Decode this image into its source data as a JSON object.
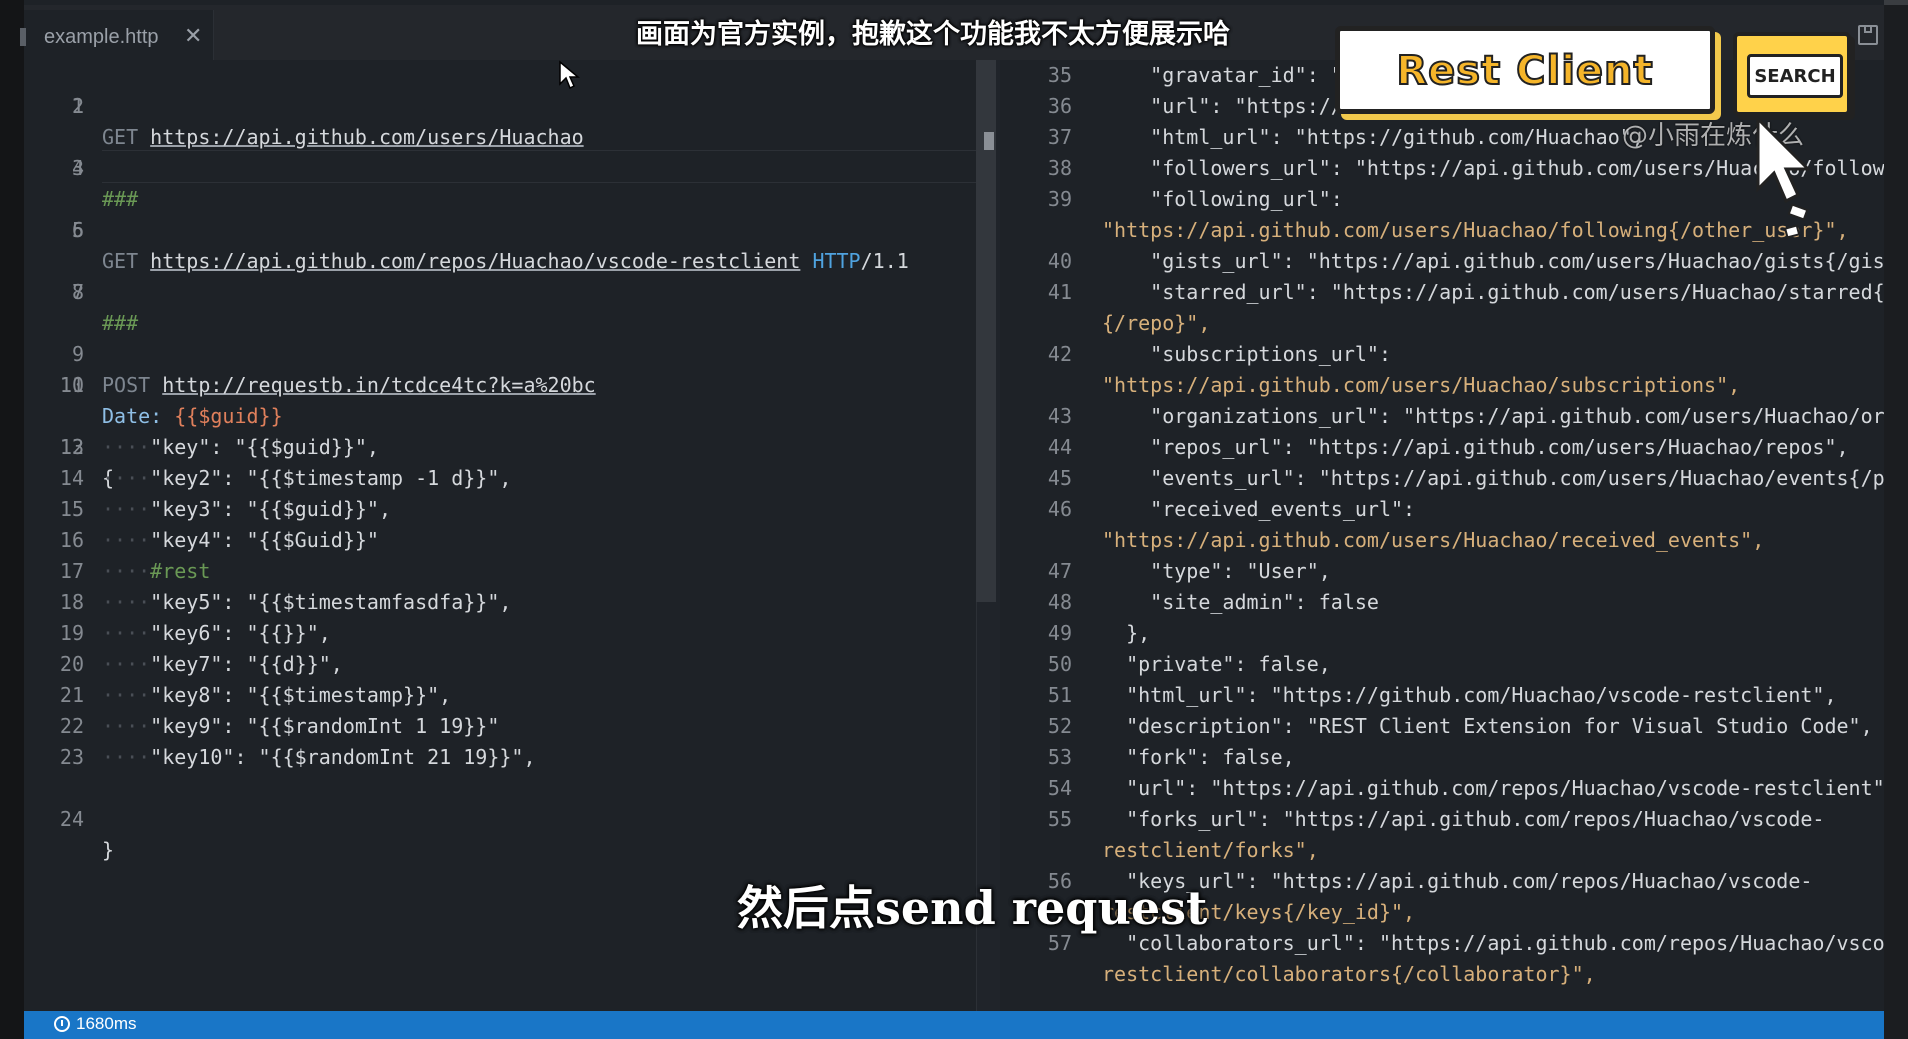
{
  "tab": {
    "filename": "example.http",
    "close": "✕"
  },
  "editor": {
    "lines": [
      {
        "n": "1"
      },
      {
        "n": "2"
      },
      {
        "n": "3"
      },
      {
        "n": "4"
      },
      {
        "n": "5"
      },
      {
        "n": "6"
      },
      {
        "n": "7"
      },
      {
        "n": "8"
      },
      {
        "n": "9"
      },
      {
        "n": "10"
      },
      {
        "n": "11"
      },
      {
        "n": "12"
      },
      {
        "n": "13"
      },
      {
        "n": "14"
      },
      {
        "n": "15"
      },
      {
        "n": "16"
      },
      {
        "n": "17"
      },
      {
        "n": "18"
      },
      {
        "n": "19"
      },
      {
        "n": "20"
      },
      {
        "n": "21"
      },
      {
        "n": "22"
      },
      {
        "n": "23"
      },
      {
        "n": "24"
      }
    ],
    "get1_method": "GET",
    "get1_url": "https://api.github.com/users/Huachao",
    "sep1": "###",
    "get2_method": "GET",
    "get2_url": "https://api.github.com/repos/Huachao/vscode-restclient",
    "get2_http": "HTTP",
    "get2_ver": "/1.1",
    "sep2": "###",
    "post_method": "POST",
    "post_url": "http://requestb.in/tcdce4tc?k=a%20bc",
    "header_name": "Date:",
    "header_value": "{{$guid}}",
    "brace_open": "{",
    "body_lines": [
      "\"key\": \"{{$guid}}\",",
      "\"key2\": \"{{$timestamp -1 d}}\",",
      "\"key3\": \"{{$guid}}\",",
      "\"key4\": \"{{$Guid}}\"",
      "#rest",
      "\"key5\": \"{{$timestamfasdfa}}\",",
      "\"key6\": \"{{}}\",",
      "\"key7\": \"{{d}}\",",
      "\"key8\": \"{{$timestamp}}\",",
      "\"key9\": \"{{$randomInt 1 19}}\"",
      "\"key10\": \"{{$randomInt 21 19}}\","
    ],
    "brace_close": "}"
  },
  "response": {
    "lines": [
      {
        "n": "35",
        "text": "    \"gravatar_id\": \"\","
      },
      {
        "n": "36",
        "text": "    \"url\": \"https://api.github.com/users/Huachao\","
      },
      {
        "n": "37",
        "text": "    \"html_url\": \"https://github.com/Huachao\","
      },
      {
        "n": "38",
        "text": "    \"followers_url\": \"https://api.github.com/users/Huachao/followers\","
      },
      {
        "n": "39",
        "text": "    \"following_url\":"
      },
      {
        "n": "",
        "text": "\"https://api.github.com/users/Huachao/following{/other_user}\","
      },
      {
        "n": "40",
        "text": "    \"gists_url\": \"https://api.github.com/users/Huachao/gists{/gist_id}\","
      },
      {
        "n": "41",
        "text": "    \"starred_url\": \"https://api.github.com/users/Huachao/starred{/owner}"
      },
      {
        "n": "",
        "text": "{/repo}\","
      },
      {
        "n": "42",
        "text": "    \"subscriptions_url\":"
      },
      {
        "n": "",
        "text": "\"https://api.github.com/users/Huachao/subscriptions\","
      },
      {
        "n": "43",
        "text": "    \"organizations_url\": \"https://api.github.com/users/Huachao/orgs\","
      },
      {
        "n": "44",
        "text": "    \"repos_url\": \"https://api.github.com/users/Huachao/repos\","
      },
      {
        "n": "45",
        "text": "    \"events_url\": \"https://api.github.com/users/Huachao/events{/privacy}\","
      },
      {
        "n": "46",
        "text": "    \"received_events_url\":"
      },
      {
        "n": "",
        "text": "\"https://api.github.com/users/Huachao/received_events\","
      },
      {
        "n": "47",
        "text": "    \"type\": \"User\","
      },
      {
        "n": "48",
        "text": "    \"site_admin\": false"
      },
      {
        "n": "49",
        "text": "  },"
      },
      {
        "n": "50",
        "text": "  \"private\": false,"
      },
      {
        "n": "51",
        "text": "  \"html_url\": \"https://github.com/Huachao/vscode-restclient\","
      },
      {
        "n": "52",
        "text": "  \"description\": \"REST Client Extension for Visual Studio Code\","
      },
      {
        "n": "53",
        "text": "  \"fork\": false,"
      },
      {
        "n": "54",
        "text": "  \"url\": \"https://api.github.com/repos/Huachao/vscode-restclient\","
      },
      {
        "n": "55",
        "text": "  \"forks_url\": \"https://api.github.com/repos/Huachao/vscode-"
      },
      {
        "n": "",
        "text": "restclient/forks\","
      },
      {
        "n": "56",
        "text": "  \"keys_url\": \"https://api.github.com/repos/Huachao/vscode-"
      },
      {
        "n": "",
        "text": "restclient/keys{/key_id}\","
      },
      {
        "n": "57",
        "text": "  \"collaborators_url\": \"https://api.github.com/repos/Huachao/vscode-"
      },
      {
        "n": "",
        "text": "restclient/collaborators{/collaborator}\","
      }
    ]
  },
  "status": {
    "elapsed": "1680ms"
  },
  "overlay": {
    "subtitle_top": "画面为官方实例，抱歉这个功能我不太方便展示哈",
    "subtitle_bottom": "然后点send request",
    "watermark": "@小雨在炼什么",
    "banner_title": "Rest Client",
    "banner_search": "SEARCH"
  },
  "colors": {
    "status_bar": "#1976c7",
    "string": "#d7b07b",
    "variable": "#e0805c",
    "comment": "#6a9955",
    "header_name": "#8fbfe6"
  },
  "icons": [
    "close-icon",
    "clock-icon",
    "save-icon",
    "mouse-cursor-icon",
    "pointer-arrow-icon"
  ]
}
